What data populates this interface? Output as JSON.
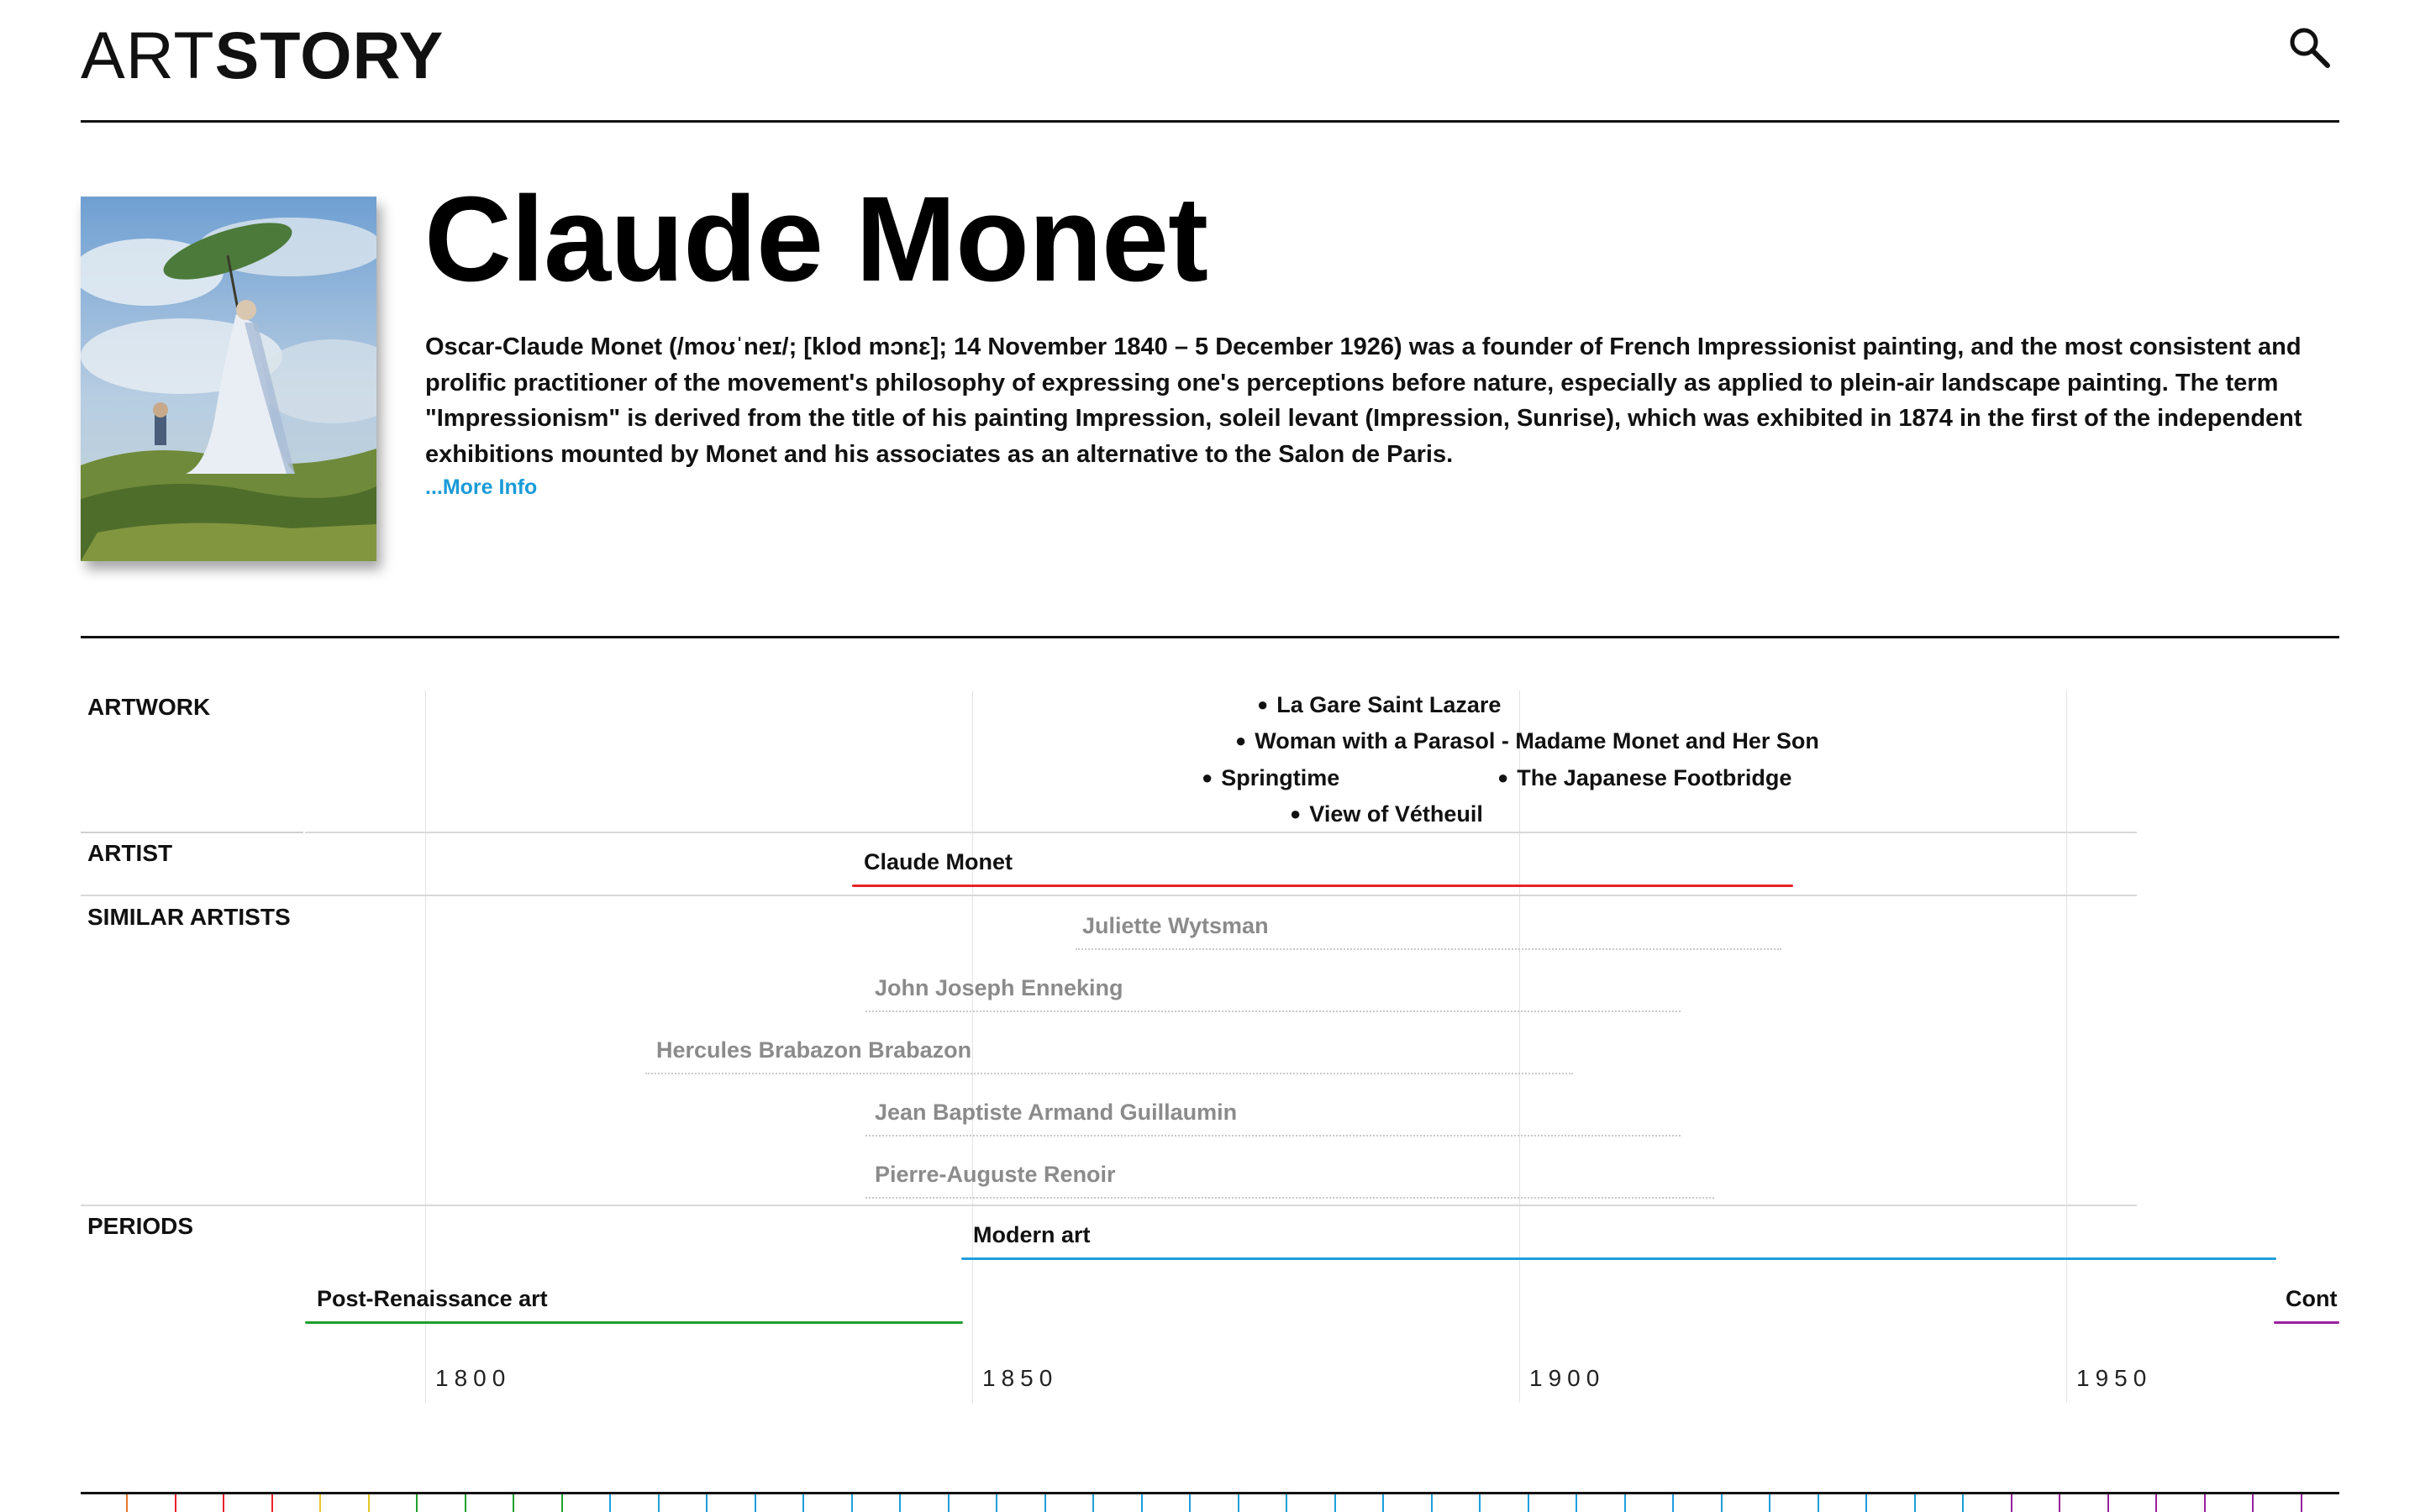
{
  "header": {
    "logo_light": "ART",
    "logo_bold": "STORY",
    "search_icon": "search-icon"
  },
  "artist": {
    "name": "Claude Monet",
    "bio": "Oscar-Claude Monet (/moʊˈneɪ/; [klod mɔnɛ]; 14 November 1840 – 5 December 1926) was a founder of French Impressionist painting, and the most consistent and prolific practitioner of the movement's philosophy of expressing one's perceptions before nature, especially as applied to plein-air landscape painting. The term \"Impressionism\" is derived from the title of his painting Impression, soleil levant (Impression, Sunrise), which was exhibited in 1874 in the first of the independent exhibitions mounted by Monet and his associates as an alternative to the Salon de Paris.",
    "more_label": "...More Info"
  },
  "timeline": {
    "section_labels": {
      "artwork": "ARTWORK",
      "artist": "ARTIST",
      "similar": "SIMILAR ARTISTS",
      "periods": "PERIODS"
    },
    "artworks": [
      "La Gare Saint Lazare",
      "Woman with a Parasol - Madame Monet and Her Son",
      "Springtime",
      "The Japanese Footbridge",
      "View of Vétheuil"
    ],
    "artist_name": "Claude Monet",
    "similar_artists": [
      "Juliette Wytsman",
      "John Joseph Enneking",
      "Hercules Brabazon Brabazon",
      "Jean Baptiste Armand Guillaumin",
      "Pierre-Auguste Renoir"
    ],
    "periods": [
      "Modern art",
      "Post-Renaissance art",
      "Cont"
    ],
    "years": [
      "1800",
      "1850",
      "1900",
      "1950"
    ]
  },
  "colors": {
    "accent_link": "#1a9bd7",
    "artist_bar": "#e8232a",
    "modern_art": "#1e9fdc",
    "post_renaissance": "#1fa02b",
    "contemporary": "#9b1fa0"
  }
}
